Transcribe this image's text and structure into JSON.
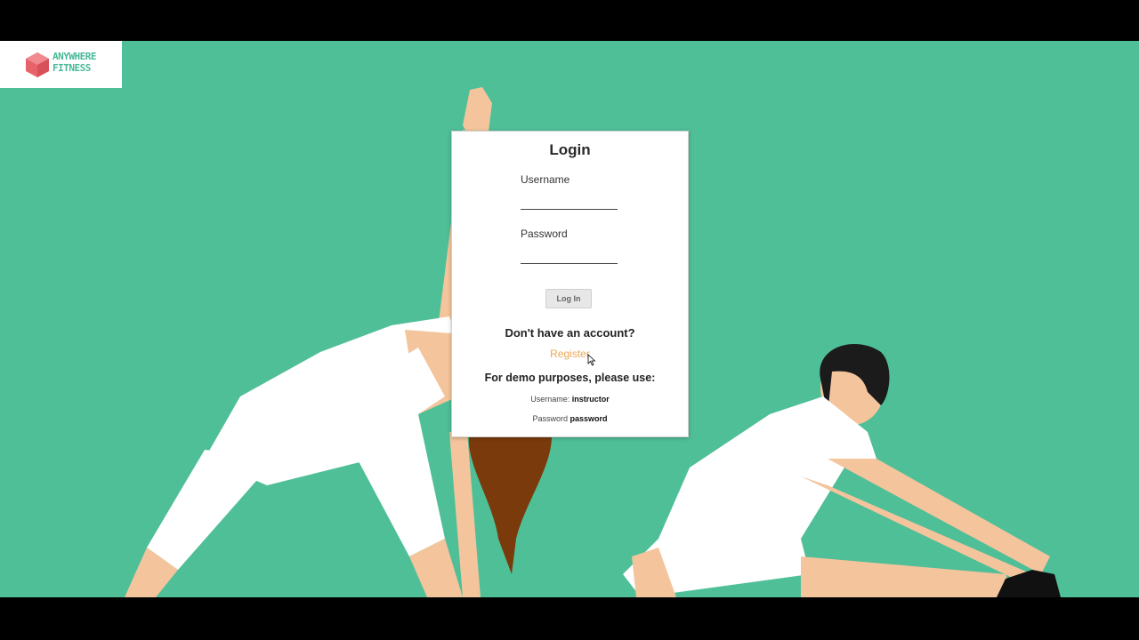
{
  "brand": {
    "line1": "ANYWHERE",
    "line2": "FITNESS",
    "accent": "#49b998",
    "mark_color": "#e8626a"
  },
  "background": {
    "color": "#4fbf98",
    "figure_color": "#ffffff",
    "skin_color": "#f4c49c",
    "hair_color": "#7a3a0c"
  },
  "login": {
    "title": "Login",
    "username_label": "Username",
    "username_value": "",
    "password_label": "Password",
    "password_value": "",
    "button_label": "Log In",
    "no_account": "Don't have an account?",
    "register_label": "Register",
    "register_color": "#e9a85b",
    "demo_note": "For demo purposes, please use:",
    "demo_username_label": "Username:",
    "demo_username_value": "instructor",
    "demo_password_label": "Password",
    "demo_password_value": "password"
  }
}
